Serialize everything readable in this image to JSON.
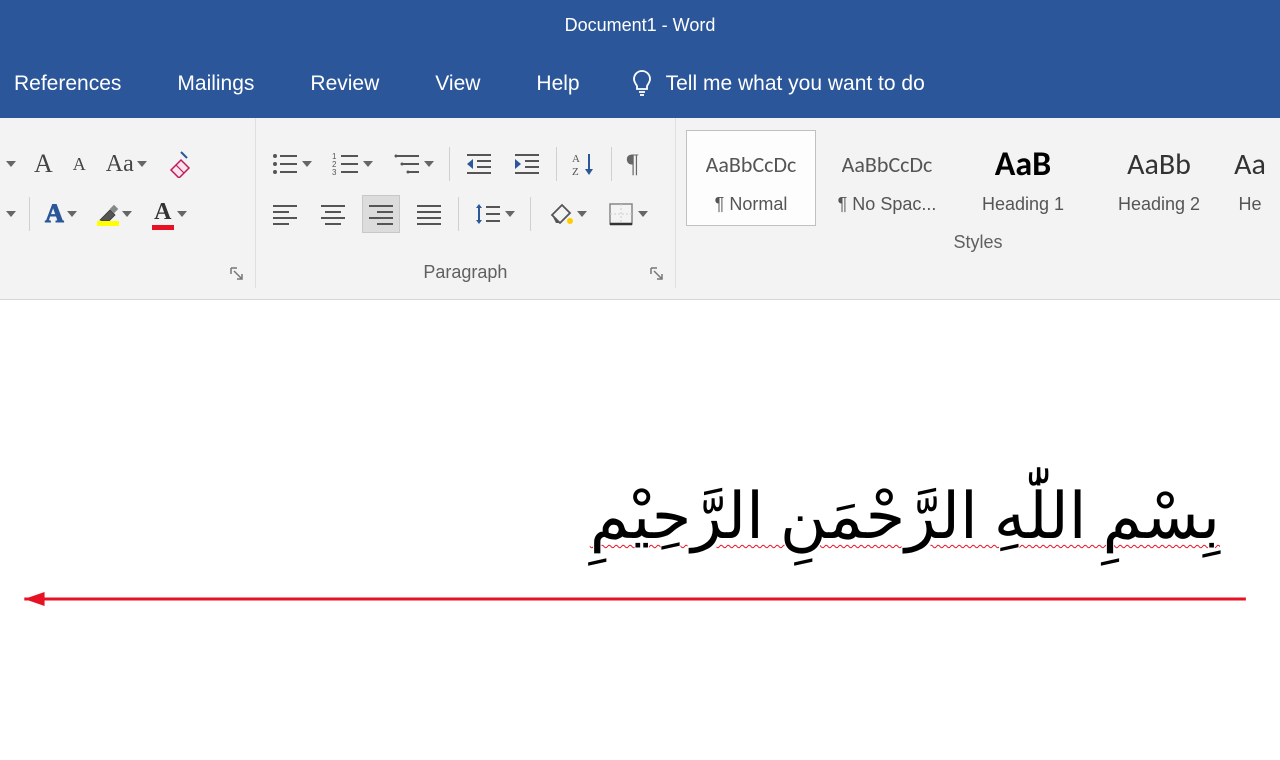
{
  "title": "Document1  -  Word",
  "tabs": {
    "references": "References",
    "mailings": "Mailings",
    "review": "Review",
    "view": "View",
    "help": "Help",
    "tellme": "Tell me what you want to do"
  },
  "font": {
    "grow": "A",
    "shrink": "A",
    "changecase": "Aa",
    "texteffects": "A",
    "highlight": "A",
    "fontcolor": "A"
  },
  "groups": {
    "paragraph": "Paragraph",
    "styles": "Styles"
  },
  "styles": {
    "normal": {
      "sample": "AaBbCcDc",
      "name": "¶ Normal"
    },
    "nospace": {
      "sample": "AaBbCcDc",
      "name": "¶ No Spac..."
    },
    "heading1": {
      "sample": "AaB",
      "name": "Heading 1"
    },
    "heading2": {
      "sample": "AaBb",
      "name": "Heading 2"
    },
    "heading3": {
      "sample": "Aa",
      "name": "He"
    }
  },
  "paragraph_icons": {
    "pilcrow": "¶"
  },
  "document": {
    "line1": "بِسْمِ اللّٰهِ الرَّحْمَنِ الرَّحِيْمِ"
  }
}
